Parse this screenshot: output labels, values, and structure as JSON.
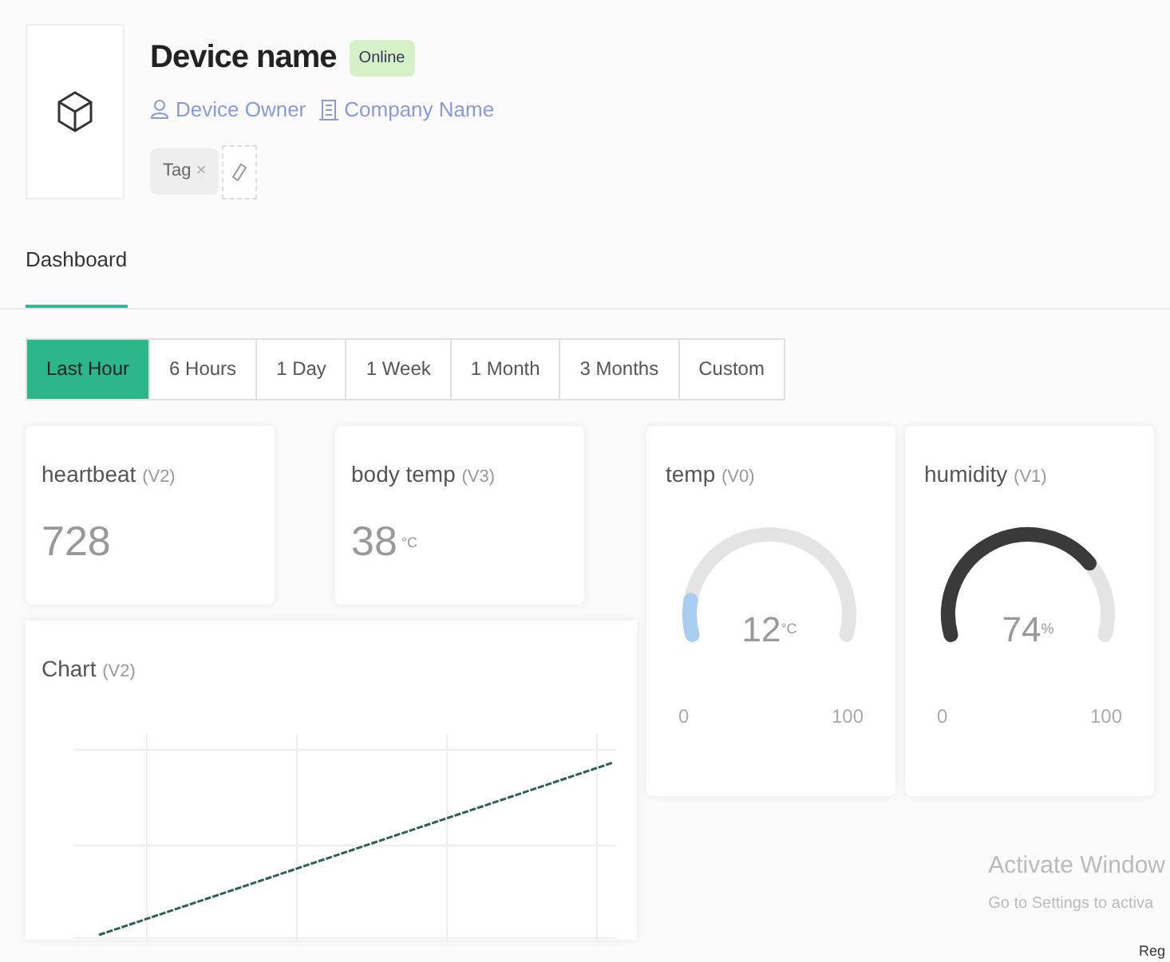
{
  "device": {
    "name": "Device name",
    "status": "Online",
    "owner": "Device Owner",
    "company": "Company Name",
    "tags": [
      {
        "label": "Tag",
        "remove": "×"
      }
    ]
  },
  "tabs": [
    {
      "label": "Dashboard",
      "selected": true
    }
  ],
  "time_ranges": [
    {
      "label": "Last Hour",
      "selected": true
    },
    {
      "label": "6 Hours",
      "selected": false
    },
    {
      "label": "1 Day",
      "selected": false
    },
    {
      "label": "1 Week",
      "selected": false
    },
    {
      "label": "1 Month",
      "selected": false
    },
    {
      "label": "3 Months",
      "selected": false
    },
    {
      "label": "Custom",
      "selected": false
    }
  ],
  "value_widgets": [
    {
      "title": "heartbeat",
      "pin": "(V2)",
      "value": "728"
    },
    {
      "title": "body temp",
      "pin": "(V3)",
      "value": "38",
      "unit": "°C"
    }
  ],
  "gauges": [
    {
      "title": "temp",
      "pin": "(V0)",
      "value": "12",
      "unit": "°C",
      "min": "0",
      "max": "100",
      "color": "#a8cdf0"
    },
    {
      "title": "humidity",
      "pin": "(V1)",
      "value": "74",
      "unit": "%",
      "min": "0",
      "max": "100",
      "color": "#3a3a3a"
    }
  ],
  "chart_widget": {
    "title": "Chart",
    "pin": "(V2)"
  },
  "os_overlay": {
    "title": "Activate Window",
    "message": "Go to Settings to activa",
    "footer": "Reg"
  }
}
